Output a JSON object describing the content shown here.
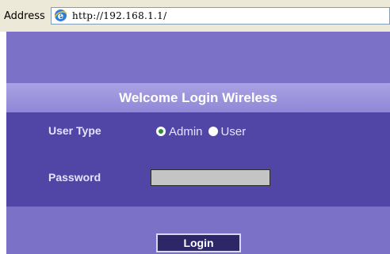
{
  "browser": {
    "address_label": "Address",
    "url": "http://192.168.1.1/",
    "icon": "ie-icon"
  },
  "login": {
    "title": "Welcome Login Wireless",
    "user_type_label": "User Type",
    "options": [
      {
        "label": "Admin",
        "selected": true
      },
      {
        "label": "User",
        "selected": false
      }
    ],
    "password_label": "Password",
    "password_value": "",
    "login_label": "Login"
  },
  "colors": {
    "page_bg": "#7b72c7",
    "header_bar": "#9d96dd",
    "form_panel": "#5146a6",
    "button": "#2d2768"
  }
}
